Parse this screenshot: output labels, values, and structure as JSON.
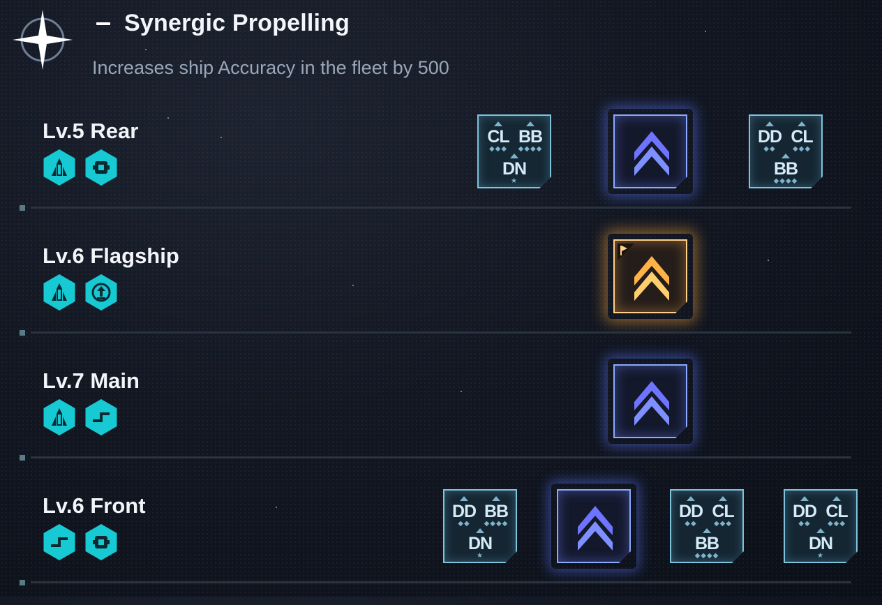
{
  "header": {
    "title": "Synergic Propelling",
    "description": "Increases ship Accuracy in the fleet by 500"
  },
  "colors": {
    "accent_cyan": "#17c9d2",
    "slot_blue": "#8aa9ff",
    "slot_gold": "#ffd08a",
    "class_border": "#7fc3dc"
  },
  "rows": [
    {
      "label": "Lv.5 Rear",
      "icons": [
        "tower-icon",
        "gear-box-icon"
      ],
      "slots": [
        {
          "type": "class",
          "classes": [
            "CL",
            "BB",
            "DN"
          ],
          "marks": [
            "◆◆◆",
            "◆◆◆◆",
            "★"
          ]
        },
        {
          "type": "ship",
          "icon": "chevron-up-icon"
        },
        {
          "type": "class",
          "classes": [
            "DD",
            "CL",
            "BB"
          ],
          "marks": [
            "◆◆",
            "◆◆◆",
            "◆◆◆◆"
          ]
        }
      ]
    },
    {
      "label": "Lv.6 Flagship",
      "icons": [
        "tower-icon",
        "upload-icon"
      ],
      "slots": [
        {
          "type": "flagship",
          "icon": "chevron-up-icon"
        }
      ]
    },
    {
      "label": "Lv.7 Main",
      "icons": [
        "tower-icon",
        "cross-icon"
      ],
      "slots": [
        {
          "type": "ship",
          "icon": "chevron-up-icon"
        }
      ]
    },
    {
      "label": "Lv.6 Front",
      "icons": [
        "cross-icon",
        "gear-box-icon"
      ],
      "slots": [
        {
          "type": "class",
          "classes": [
            "DD",
            "BB",
            "DN"
          ],
          "marks": [
            "◆◆",
            "◆◆◆◆",
            "★"
          ]
        },
        {
          "type": "ship",
          "icon": "chevron-up-icon"
        },
        {
          "type": "class",
          "classes": [
            "DD",
            "CL",
            "BB"
          ],
          "marks": [
            "◆◆",
            "◆◆◆",
            "◆◆◆◆"
          ]
        },
        {
          "type": "class",
          "classes": [
            "DD",
            "CL",
            "DN"
          ],
          "marks": [
            "◆◆",
            "◆◆◆",
            "★"
          ]
        }
      ]
    }
  ]
}
